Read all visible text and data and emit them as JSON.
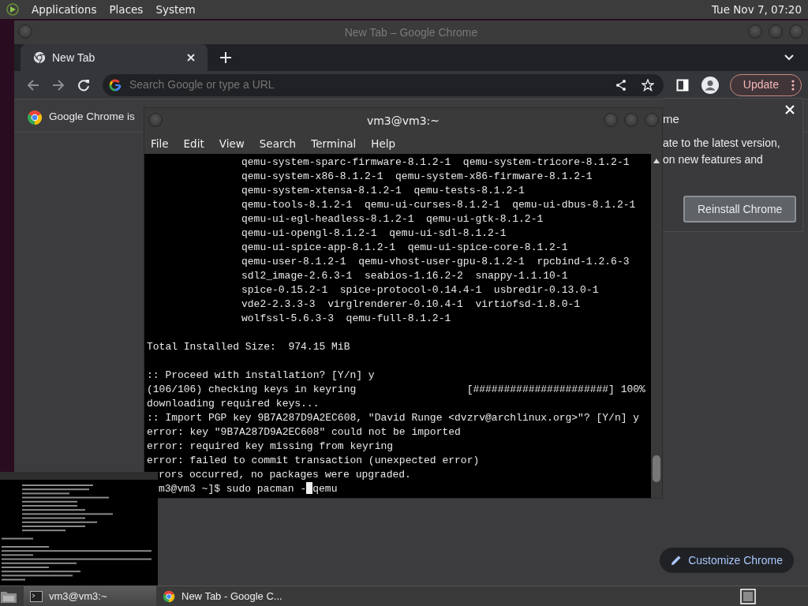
{
  "top_panel": {
    "menus": [
      "Applications",
      "Places",
      "System"
    ],
    "clock": "Tue Nov 7, 07:20"
  },
  "chrome": {
    "title": "New Tab – Google Chrome",
    "tabs": [
      {
        "label": "New Tab",
        "selected": true
      }
    ],
    "omnibox": {
      "placeholder": "Search Google or type a URL"
    },
    "update_button": "Update",
    "infobar": {
      "text": "Google Chrome is"
    },
    "bubble": {
      "title": "me",
      "lines": [
        "ate to the latest version,",
        "on new features and"
      ],
      "button": "Reinstall Chrome"
    },
    "customize_button": "Customize Chrome"
  },
  "terminal": {
    "title": "vm3@vm3:~",
    "menu": [
      "File",
      "Edit",
      "View",
      "Search",
      "Terminal",
      "Help"
    ],
    "lines": [
      {
        "kind": "package",
        "text": "qemu-system-sparc-firmware-8.1.2-1  qemu-system-tricore-8.1.2-1"
      },
      {
        "kind": "package",
        "text": "qemu-system-x86-8.1.2-1  qemu-system-x86-firmware-8.1.2-1"
      },
      {
        "kind": "package",
        "text": "qemu-system-xtensa-8.1.2-1  qemu-tests-8.1.2-1"
      },
      {
        "kind": "package",
        "text": "qemu-tools-8.1.2-1  qemu-ui-curses-8.1.2-1  qemu-ui-dbus-8.1.2-1"
      },
      {
        "kind": "package",
        "text": "qemu-ui-egl-headless-8.1.2-1  qemu-ui-gtk-8.1.2-1"
      },
      {
        "kind": "package",
        "text": "qemu-ui-opengl-8.1.2-1  qemu-ui-sdl-8.1.2-1"
      },
      {
        "kind": "package",
        "text": "qemu-ui-spice-app-8.1.2-1  qemu-ui-spice-core-8.1.2-1"
      },
      {
        "kind": "package",
        "text": "qemu-user-8.1.2-1  qemu-vhost-user-gpu-8.1.2-1  rpcbind-1.2.6-3"
      },
      {
        "kind": "package",
        "text": "sdl2_image-2.6.3-1  seabios-1.16.2-2  snappy-1.1.10-1"
      },
      {
        "kind": "package",
        "text": "spice-0.15.2-1  spice-protocol-0.14.4-1  usbredir-0.13.0-1"
      },
      {
        "kind": "package",
        "text": "vde2-2.3.3-3  virglrenderer-0.10.4-1  virtiofsd-1.8.0-1"
      },
      {
        "kind": "package",
        "text": "wolfssl-5.6.3-3  qemu-full-8.1.2-1"
      },
      {
        "kind": "blank"
      },
      {
        "kind": "output",
        "text": "Total Installed Size:  974.15 MiB"
      },
      {
        "kind": "blank"
      },
      {
        "kind": "output",
        "text": ":: Proceed with installation? [Y/n] y"
      },
      {
        "kind": "output",
        "text": "(106/106) checking keys in keyring                  [######################] 100%"
      },
      {
        "kind": "output",
        "text": "downloading required keys..."
      },
      {
        "kind": "output",
        "text": ":: Import PGP key 9B7A287D9A2EC608, \"David Runge <dvzrv@archlinux.org>\"? [Y/n] y"
      },
      {
        "kind": "output",
        "text": "error: key \"9B7A287D9A2EC608\" could not be imported"
      },
      {
        "kind": "output",
        "text": "error: required key missing from keyring"
      },
      {
        "kind": "output",
        "text": "error: failed to commit transaction (unexpected error)"
      },
      {
        "kind": "covered",
        "text": "rors occurred, no packages were upgraded."
      },
      {
        "kind": "prompt",
        "text": "m3@vm3 ~]$ sudo pacman -",
        "after": "qemu"
      }
    ]
  },
  "taskbar": {
    "tasks": [
      {
        "label": "vm3@vm3:~",
        "kind": "terminal",
        "selected": true
      },
      {
        "label": "New Tab - Google C...",
        "kind": "browser",
        "selected": false
      }
    ]
  }
}
